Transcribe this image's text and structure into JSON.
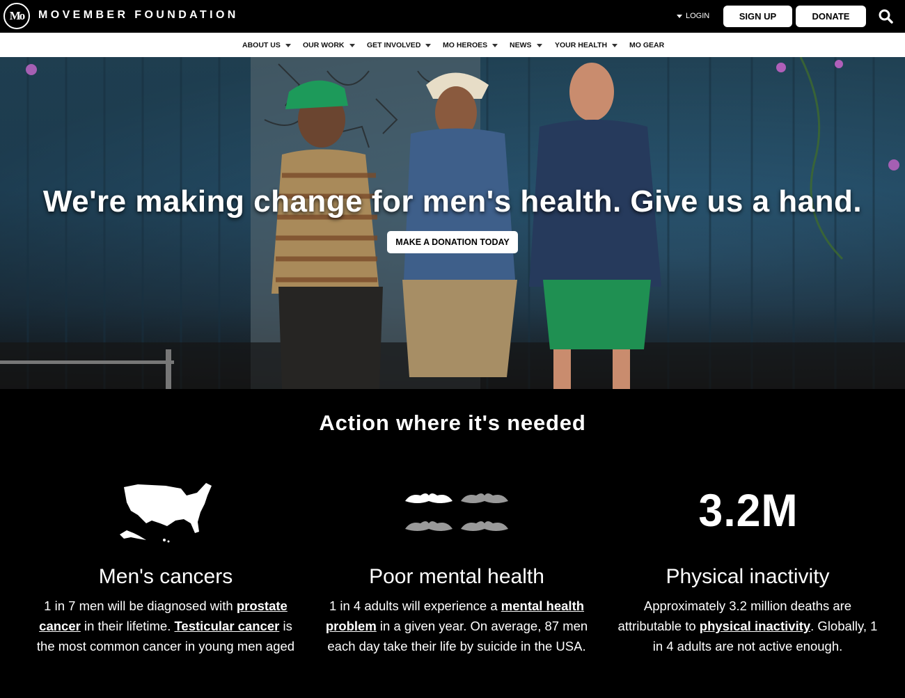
{
  "header": {
    "brand": "MOVEMBER FOUNDATION",
    "login_label": "LOGIN",
    "signup_label": "SIGN UP",
    "donate_label": "DONATE"
  },
  "nav": {
    "items": [
      {
        "label": "ABOUT US",
        "dropdown": true
      },
      {
        "label": "OUR WORK",
        "dropdown": true
      },
      {
        "label": "GET INVOLVED",
        "dropdown": true
      },
      {
        "label": "MO HEROES",
        "dropdown": true
      },
      {
        "label": "NEWS",
        "dropdown": true
      },
      {
        "label": "YOUR HEALTH",
        "dropdown": true
      },
      {
        "label": "MO GEAR",
        "dropdown": false
      }
    ]
  },
  "hero": {
    "headline": "We're making change for men's health. Give us a hand.",
    "cta_label": "MAKE A DONATION TODAY"
  },
  "section": {
    "title": "Action where it's needed",
    "columns": [
      {
        "icon": "usa-map-icon",
        "title": "Men's cancers",
        "text_parts": [
          {
            "t": "1 in 7 men will be diagnosed with ",
            "link": false
          },
          {
            "t": "prostate cancer",
            "link": true
          },
          {
            "t": " in their lifetime. ",
            "link": false
          },
          {
            "t": "Testicular cancer",
            "link": true
          },
          {
            "t": " is the most common cancer in young men aged",
            "link": false
          }
        ]
      },
      {
        "icon": "moustaches-icon",
        "title": "Poor mental health",
        "text_parts": [
          {
            "t": "1 in 4 adults will experience a ",
            "link": false
          },
          {
            "t": "mental health problem",
            "link": true
          },
          {
            "t": " in a given year. On average, 87 men each day take their life by suicide in the USA.",
            "link": false
          }
        ]
      },
      {
        "icon": "",
        "stat": "3.2M",
        "title": "Physical inactivity",
        "text_parts": [
          {
            "t": "Approximately 3.2 million deaths are attributable to ",
            "link": false
          },
          {
            "t": "physical inactivity",
            "link": true
          },
          {
            "t": ". Globally, 1 in 4 adults are not active enough.",
            "link": false
          }
        ]
      }
    ]
  }
}
